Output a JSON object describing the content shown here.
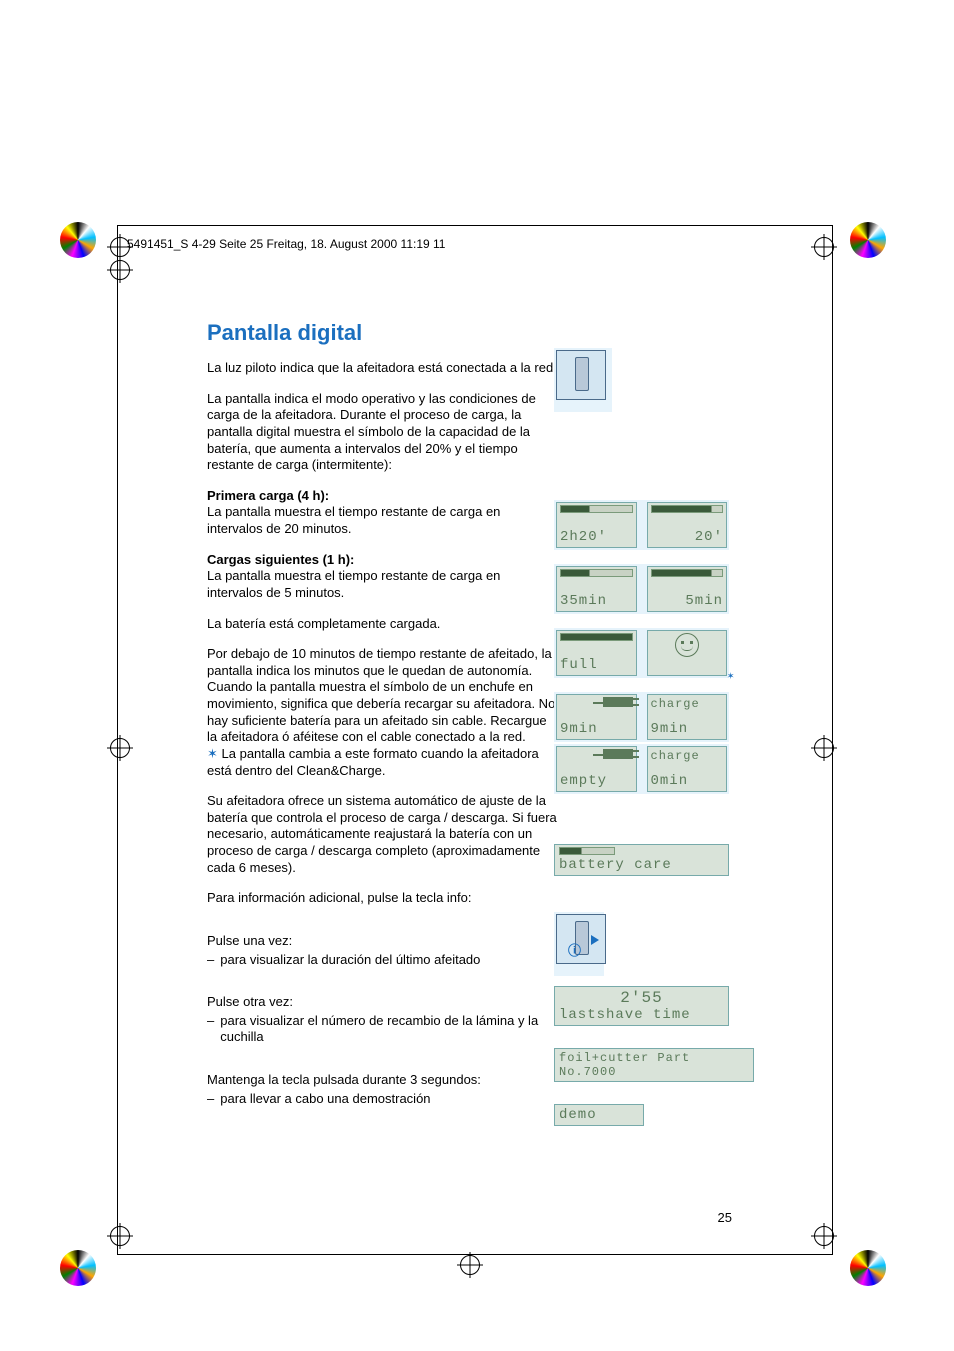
{
  "header": "5491451_S 4-29  Seite 25  Freitag, 18. August 2000  11:19 11",
  "title": "Pantalla digital",
  "intro1": "La luz piloto indica que la afeitadora está conectada a la red.",
  "intro2": "La pantalla indica el modo operativo y las condiciones de carga de la afeitadora. Durante el proceso de carga, la pantalla digital muestra el símbolo de la capacidad de la batería, que aumenta a intervalos del 20% y el tiempo restante de carga (intermitente):",
  "first_charge_h": "Primera carga (4 h):",
  "first_charge_t": "La pantalla muestra el tiempo restante de carga en intervalos de 20 minutos.",
  "next_charge_h": "Cargas siguientes (1 h):",
  "next_charge_t": "La pantalla muestra el tiempo restante de carga en intervalos de 5 minutos.",
  "full_t": "La batería está completamente cargada.",
  "below10": "Por debajo de 10 minutos de tiempo restante de afeitado, la pantalla indica los minutos que le quedan de autonomía. Cuando la pantalla muestra el símbolo de un enchufe en movimiento, significa que debería recargar su afeitadora. No hay suficiente batería para un afeitado sin cable. Recargue la afeitadora ó aféitese con el cable conectado a la red.",
  "cc_note": "La pantalla cambia a este formato cuando la afeitadora está dentro del Clean&Charge.",
  "auto_adj": "Su afeitadora ofrece un sistema automático de ajuste de la batería que controla el proceso de carga / descarga. Si fuera necesario, automáticamente reajustará la batería con un proceso de carga / descarga completo (aproximadamente cada 6 meses).",
  "info_hint": "Para información adicional, pulse la tecla info:",
  "press_once": "Pulse una vez:",
  "press_once_b": "para visualizar la duración del último afeitado",
  "press_again": "Pulse otra vez:",
  "press_again_b": "para visualizar el número de recambio de la lámina y la cuchilla",
  "hold3": "Mantenga la tecla pulsada durante 3 segundos:",
  "hold3_b": "para llevar a cabo una demostración",
  "page_num": "25",
  "lcd": {
    "r1a": "2h20'",
    "r1b": "20'",
    "r2a": "35min",
    "r2b": "5min",
    "r3a": "full",
    "r4a": "9min",
    "r4b_top": "charge",
    "r4b_bot": "9min",
    "r5a": "empty",
    "r5b_top": "charge",
    "r5b_bot": "0min",
    "battery_care": "battery care",
    "last_time_num": "2'55",
    "last_time_lbl": "lastshave time",
    "foil": "foil+cutter Part No.7000",
    "demo": "demo"
  }
}
